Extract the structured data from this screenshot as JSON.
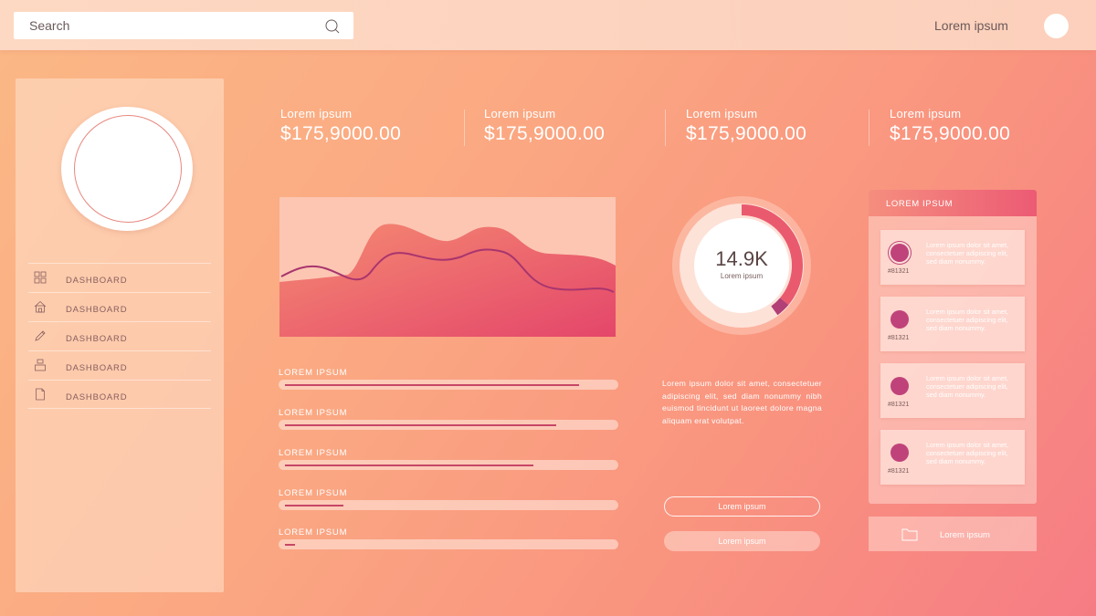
{
  "topbar": {
    "search_placeholder": "Search",
    "user_name": "Lorem ipsum"
  },
  "sidebar": {
    "items": [
      {
        "label": "DASHBOARD",
        "icon": "grid-icon"
      },
      {
        "label": "DASHBOARD",
        "icon": "home-icon"
      },
      {
        "label": "DASHBOARD",
        "icon": "pencil-icon"
      },
      {
        "label": "DASHBOARD",
        "icon": "stack-icon"
      },
      {
        "label": "DASHBOARD",
        "icon": "document-icon"
      }
    ]
  },
  "stats": [
    {
      "label": "Lorem ipsum",
      "value": "$175,9000.00"
    },
    {
      "label": "Lorem ipsum",
      "value": "$175,9000.00"
    },
    {
      "label": "Lorem ipsum",
      "value": "$175,9000.00"
    },
    {
      "label": "Lorem ipsum",
      "value": "$175,9000.00"
    }
  ],
  "progress": [
    {
      "label": "LOREM IPSUM",
      "fraction": 0.9
    },
    {
      "label": "LOREM IPSUM",
      "fraction": 0.83
    },
    {
      "label": "LOREM IPSUM",
      "fraction": 0.76
    },
    {
      "label": "LOREM IPSUM",
      "fraction": 0.18
    },
    {
      "label": "LOREM IPSUM",
      "fraction": 0.03
    }
  ],
  "donut": {
    "value": "14.9K",
    "caption": "Lorem ipsum",
    "fraction": 0.4
  },
  "paragraph": "Lorem ipsum dolor sit amet, consectetuer adipiscing elit, sed diam nonummy nibh euismod tincidunt ut laoreet dolore magna aliquam erat volutpat.",
  "buttons": {
    "outline_label": "Lorem ipsum",
    "filled_label": "Lorem ipsum"
  },
  "panel": {
    "title": "LOREM IPSUM",
    "cards": [
      {
        "id": "#81321",
        "text": "Lorem ipsum dolor sit amet, consectetuer adipiscing elit, sed diam nonummy."
      },
      {
        "id": "#81321",
        "text": "Lorem ipsum dolor sit amet, consectetuer adipiscing elit, sed diam nonummy."
      },
      {
        "id": "#81321",
        "text": "Lorem ipsum dolor sit amet, consectetuer adipiscing elit, sed diam nonummy."
      },
      {
        "id": "#81321",
        "text": "Lorem ipsum dolor sit amet, consectetuer adipiscing elit, sed diam nonummy."
      }
    ]
  },
  "footer": {
    "label": "Lorem ipsum",
    "icon": "folder-icon"
  },
  "colors": {
    "accent": "#c0427a",
    "chart_area": "#e9606d",
    "chart_line": "#a8356e"
  }
}
